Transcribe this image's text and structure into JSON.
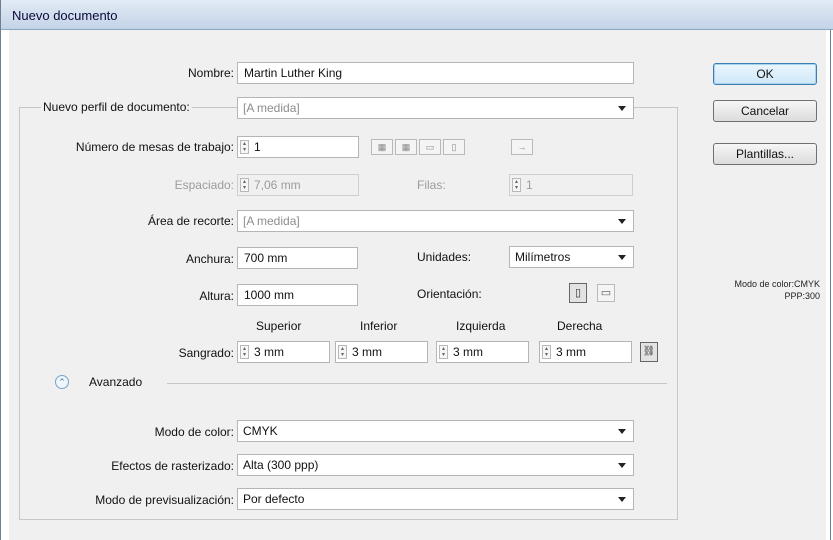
{
  "window": {
    "title": "Nuevo documento"
  },
  "form": {
    "nombre": {
      "label": "Nombre:",
      "value": "Martin Luther King"
    },
    "perfil": {
      "label": "Nuevo perfil de documento:",
      "value": "[A medida]"
    },
    "mesas": {
      "label": "Número de mesas de trabajo:",
      "value": "1"
    },
    "espaciado": {
      "label": "Espaciado:",
      "value": "7,06 mm"
    },
    "filas": {
      "label": "Filas:",
      "value": "1"
    },
    "recorte": {
      "label": "Área de recorte:",
      "value": "[A medida]"
    },
    "anchura": {
      "label": "Anchura:",
      "value": "700 mm"
    },
    "unidades": {
      "label": "Unidades:",
      "value": "Milímetros"
    },
    "altura": {
      "label": "Altura:",
      "value": "1000 mm"
    },
    "orientacion": {
      "label": "Orientación:"
    },
    "sangrado": {
      "label": "Sangrado:",
      "headers": [
        "Superior",
        "Inferior",
        "Izquierda",
        "Derecha"
      ],
      "values": [
        "3 mm",
        "3 mm",
        "3 mm",
        "3 mm"
      ]
    },
    "avanzado": {
      "label": "Avanzado"
    },
    "modo_color": {
      "label": "Modo de color:",
      "value": "CMYK"
    },
    "rasterizado": {
      "label": "Efectos de rasterizado:",
      "value": "Alta (300 ppp)"
    },
    "previsualizacion": {
      "label": "Modo de previsualización:",
      "value": "Por defecto"
    }
  },
  "buttons": {
    "ok": "OK",
    "cancel": "Cancelar",
    "templates": "Plantillas..."
  },
  "summary": {
    "line1": "Modo de color:CMYK",
    "line2": "PPP:300"
  }
}
